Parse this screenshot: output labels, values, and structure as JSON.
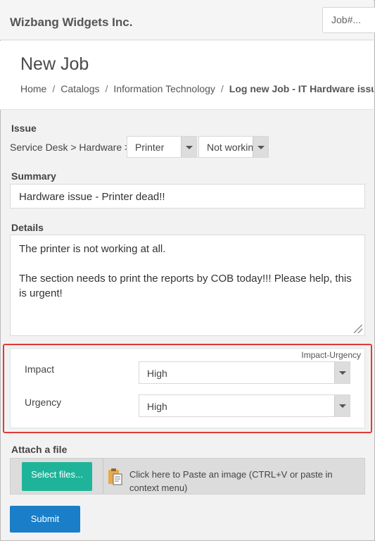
{
  "app": {
    "brand": "Wizbang Widgets Inc.",
    "job_search_placeholder": "Job#..."
  },
  "page": {
    "title": "New Job",
    "breadcrumb": [
      "Home",
      "Catalogs",
      "Information Technology",
      "Log new Job - IT Hardware issue"
    ]
  },
  "form": {
    "issue_label": "Issue",
    "service_path": "Service Desk > Hardware >",
    "issue_select_1": "Printer",
    "issue_select_2": "Not workin",
    "summary_label": "Summary",
    "summary_value": "Hardware issue - Printer dead!!",
    "details_label": "Details",
    "details_lines": [
      "The printer is not working at all.",
      "The section needs to print the reports by COB today!!!  Please help, this is urgent!"
    ],
    "impact_urgency_title": "Impact-Urgency",
    "impact_label": "Impact",
    "impact_value": "High",
    "urgency_label": "Urgency",
    "urgency_value": "High",
    "attach_label": "Attach a file",
    "select_files_label": "Select files...",
    "paste_text": "Click here to Paste an image (CTRL+V or paste in context menu)",
    "submit_label": "Submit"
  },
  "colors": {
    "highlight": "#e03a3a",
    "select_files": "#1fb49a",
    "submit": "#1a7ec8"
  }
}
